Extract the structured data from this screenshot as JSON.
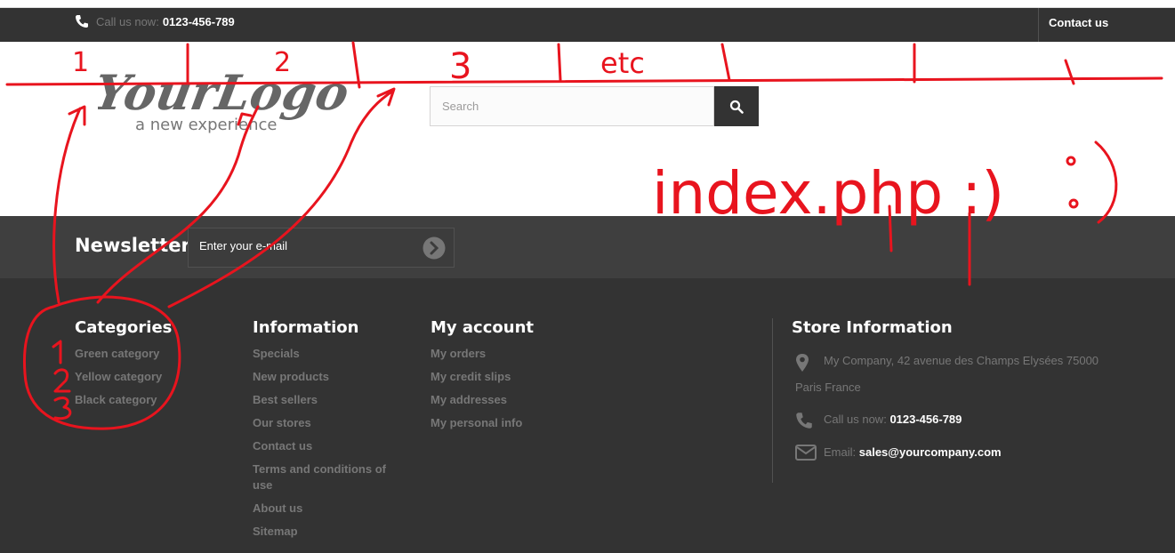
{
  "topbar": {
    "call_label": "Call us now:",
    "call_number": "0123-456-789",
    "contact_label": "Contact us"
  },
  "header": {
    "logo": {
      "line1": "YourLogo",
      "line2": "a new experience"
    },
    "search": {
      "placeholder": "Search"
    }
  },
  "newsletter": {
    "title": "Newsletter",
    "input_placeholder": "Enter your e-mail"
  },
  "footer": {
    "categories": {
      "title": "Categories",
      "items": [
        "Green category",
        "Yellow category",
        "Black category"
      ]
    },
    "information": {
      "title": "Information",
      "items": [
        "Specials",
        "New products",
        "Best sellers",
        "Our stores",
        "Contact us",
        "Terms and conditions of use",
        "About us",
        "Sitemap"
      ]
    },
    "account": {
      "title": "My account",
      "items": [
        "My orders",
        "My credit slips",
        "My addresses",
        "My personal info"
      ]
    },
    "store": {
      "title": "Store Information",
      "address_line1": "My Company, 42 avenue des Champs Elysées 75000",
      "address_line2": "Paris France",
      "call_label": "Call us now:",
      "call_number": "0123-456-789",
      "email_label": "Email:",
      "email": "sales@yourcompany.com"
    }
  },
  "annotations": {
    "top_numbers": [
      "1",
      "2",
      "3",
      "etc"
    ],
    "side_numbers": [
      "1",
      "2",
      "3"
    ],
    "note": "index.php :)"
  },
  "colors": {
    "dark": "#333333",
    "newsletter_bg": "#3f3f3f",
    "text_muted": "#777777",
    "annotation_red": "#e8141e"
  }
}
